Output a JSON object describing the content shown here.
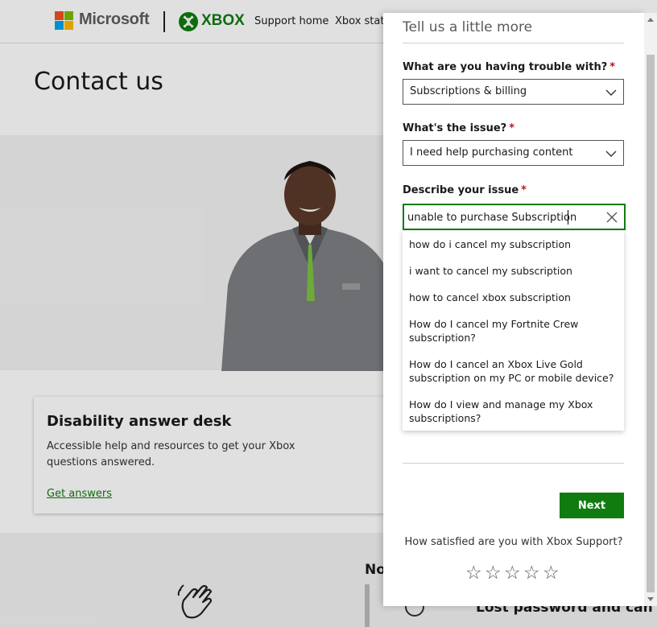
{
  "header": {
    "brand": "Microsoft",
    "product": "XBOX",
    "nav": [
      "Support home",
      "Xbox status"
    ]
  },
  "page": {
    "title": "Contact us"
  },
  "card": {
    "title": "Disability answer desk",
    "description": "Accessible help and resources to get your Xbox questions answered.",
    "link": "Get answers"
  },
  "bottom": {
    "heading_partial": "No",
    "item_partial": "Lost password and can't sig"
  },
  "panel": {
    "title": "Tell us a little more",
    "required_mark": "*",
    "trouble": {
      "label": "What are you having trouble with?",
      "value": "Subscriptions & billing"
    },
    "issue": {
      "label": "What's the issue?",
      "value": "I need help purchasing content"
    },
    "describe": {
      "label": "Describe your issue",
      "value": "unable to purchase Subscription"
    },
    "suggestions": [
      "how do i cancel my subscription",
      "i want to cancel my subscription",
      "how to cancel xbox subscription",
      "How do I cancel my Fortnite Crew subscription?",
      "How do I cancel an Xbox Live Gold subscription on my PC or mobile device?",
      "How do I view and manage my Xbox subscriptions?"
    ],
    "next_label": "Next",
    "satisfaction_question": "How satisfied are you with Xbox Support?",
    "rating": {
      "max": 5,
      "value": 0,
      "glyph": "☆"
    }
  },
  "colors": {
    "accent": "#107c10",
    "required": "#c50f1f",
    "ms_red": "#f25022",
    "ms_green": "#7fba00",
    "ms_blue": "#00a4ef",
    "ms_yellow": "#ffb900"
  },
  "icons": [
    "microsoft-logo-icon",
    "xbox-logo-icon",
    "chevron-down-icon",
    "clear-icon",
    "star-icon",
    "wave-hand-icon",
    "info-icon"
  ]
}
